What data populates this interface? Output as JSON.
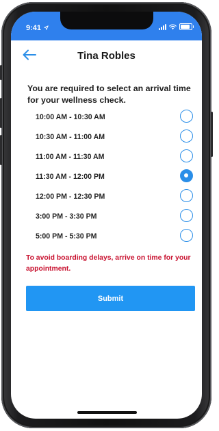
{
  "status_bar": {
    "time": "9:41",
    "icons": [
      "location-arrow-icon",
      "signal-icon",
      "wifi-icon",
      "battery-icon"
    ],
    "color": "#2f80ed"
  },
  "header": {
    "back_icon": "back-arrow-icon",
    "title": "Tina Robles"
  },
  "instruction": "You are required to select an arrival time for your wellness check.",
  "time_slots": [
    {
      "label": "10:00 AM - 10:30 AM",
      "selected": false
    },
    {
      "label": "10:30 AM - 11:00 AM",
      "selected": false
    },
    {
      "label": "11:00 AM - 11:30 AM",
      "selected": false
    },
    {
      "label": "11:30 AM - 12:00 PM",
      "selected": true
    },
    {
      "label": "12:00 PM - 12:30 PM",
      "selected": false
    },
    {
      "label": "3:00 PM - 3:30 PM",
      "selected": false
    },
    {
      "label": "5:00 PM - 5:30 PM",
      "selected": false
    }
  ],
  "warning": "To avoid boarding delays, arrive on time for your appointment.",
  "submit_label": "Submit",
  "colors": {
    "accent": "#2196f3",
    "radio": "#2a8ee8",
    "warning": "#c8102e"
  }
}
